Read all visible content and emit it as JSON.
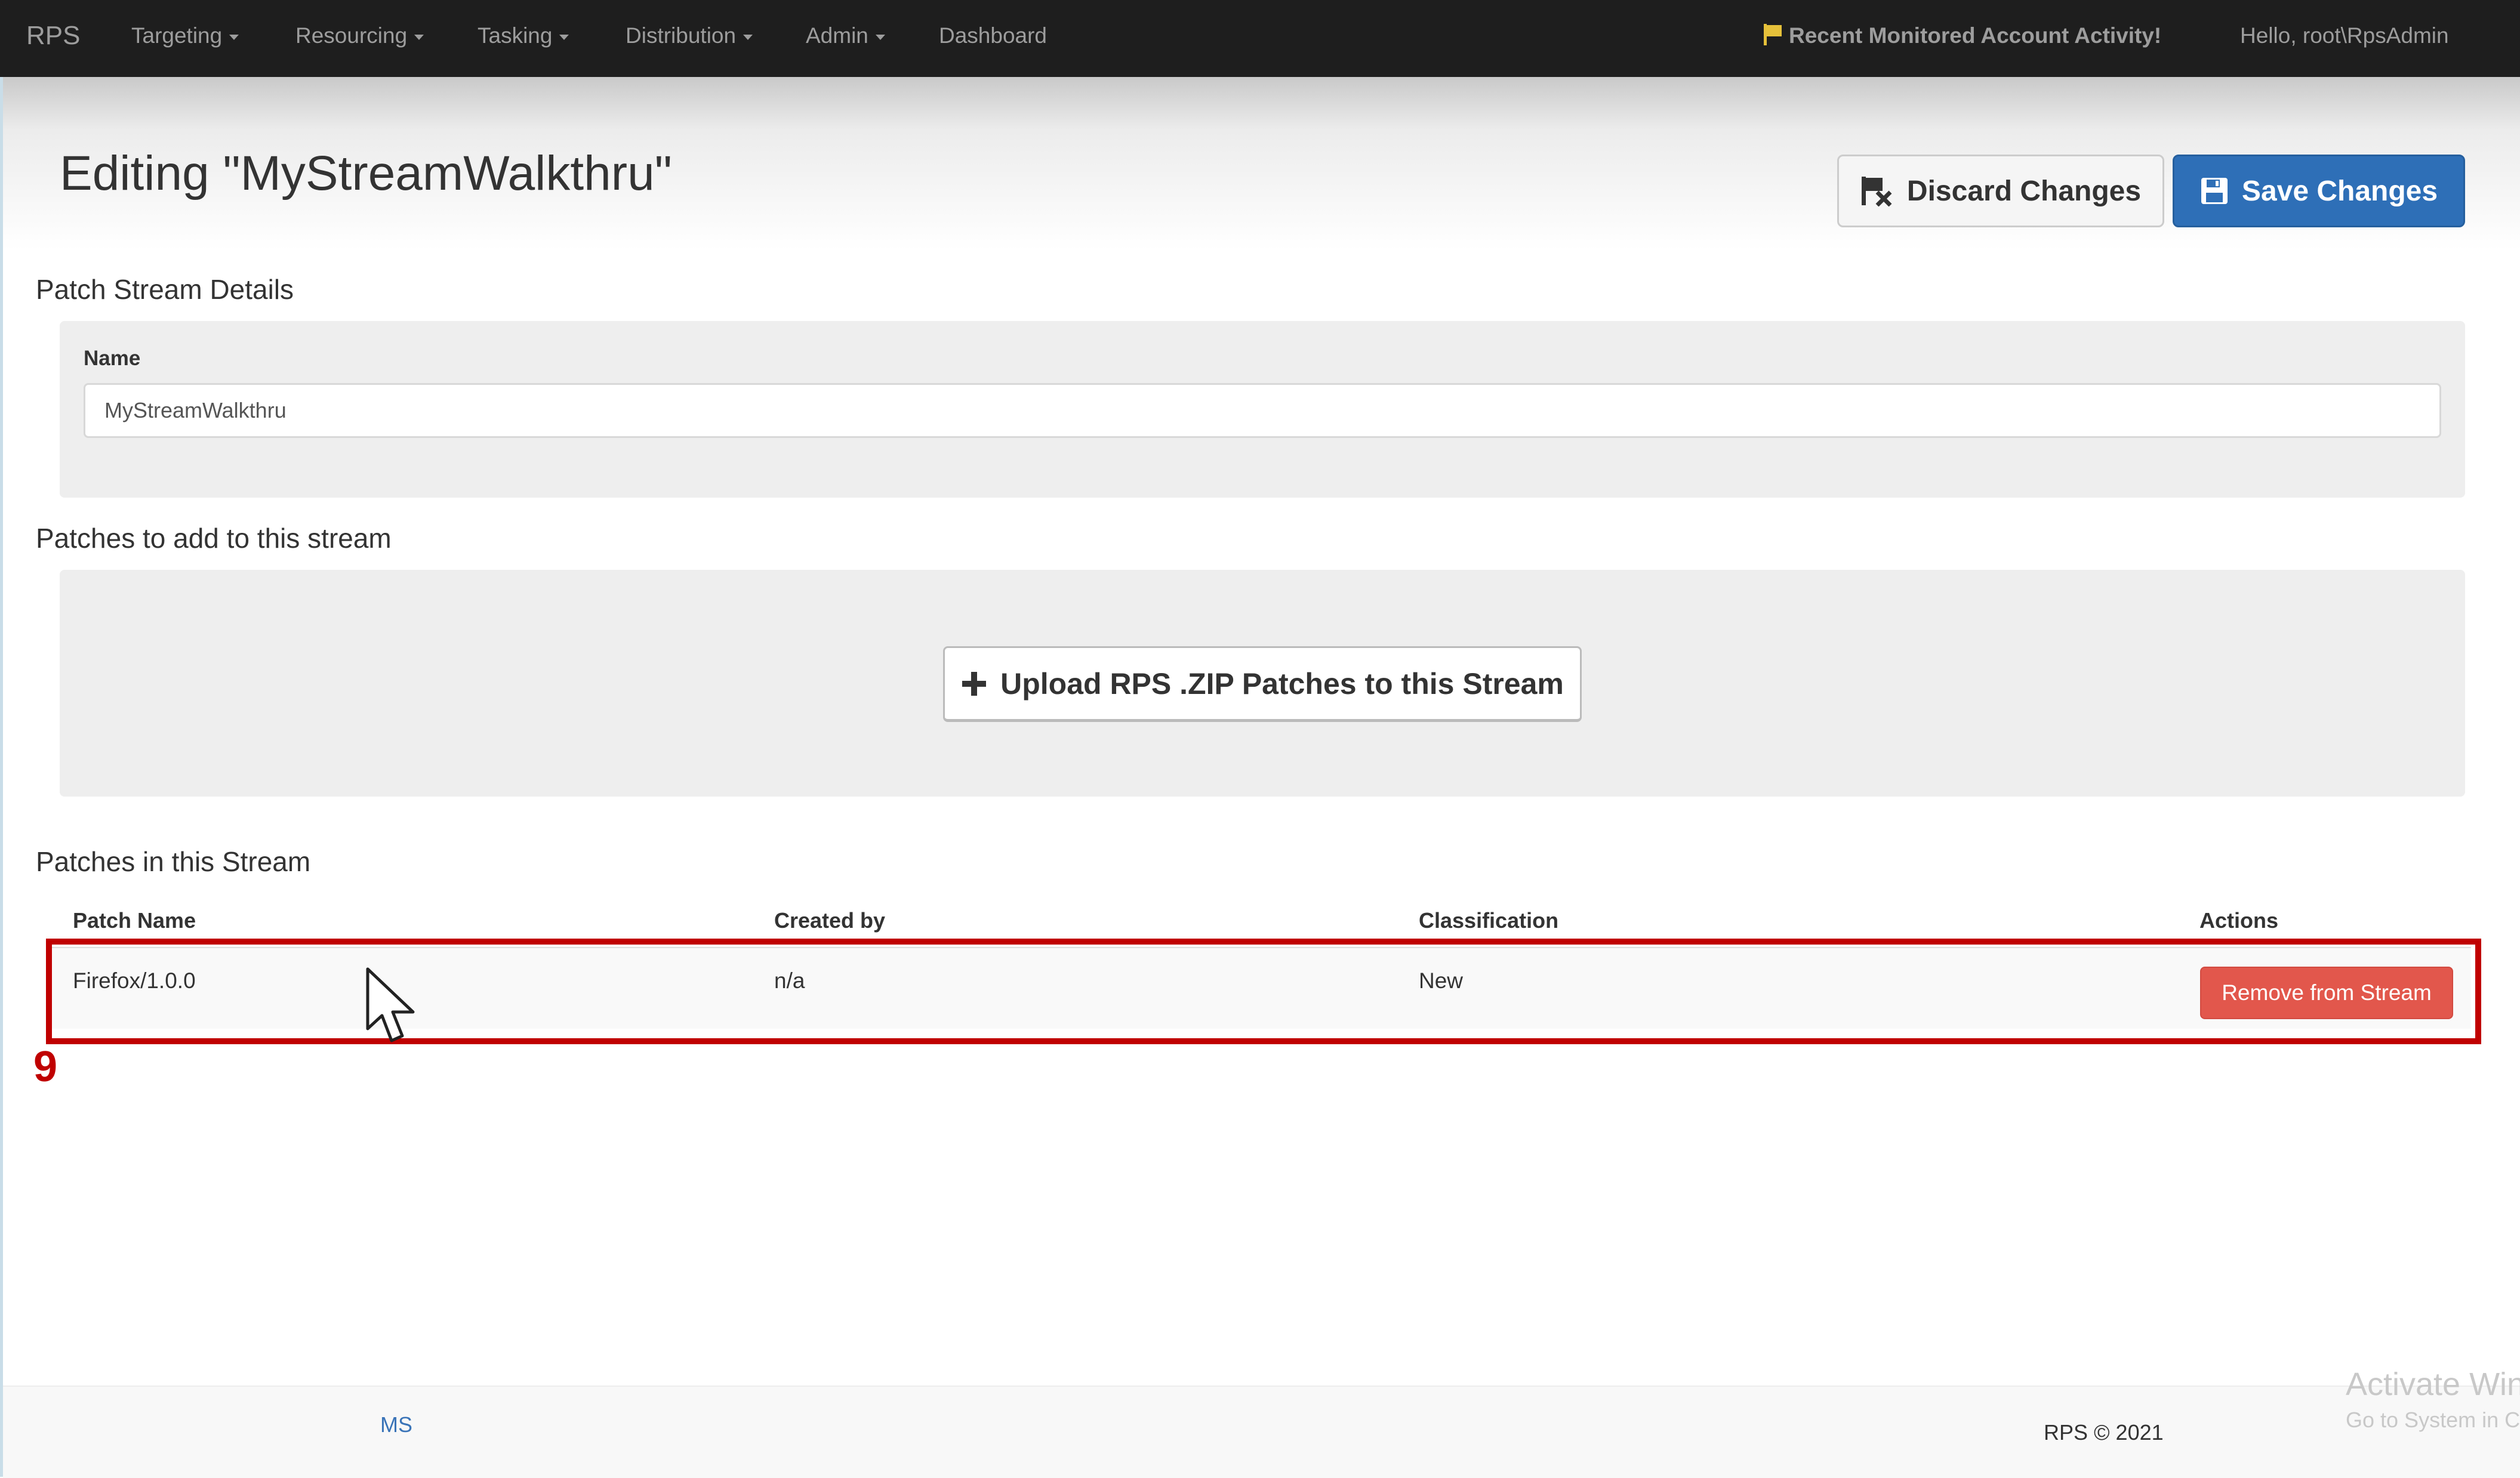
{
  "nav": {
    "brand": "RPS",
    "items": [
      {
        "label": "Targeting",
        "has_caret": true
      },
      {
        "label": "Resourcing",
        "has_caret": true
      },
      {
        "label": "Tasking",
        "has_caret": true
      },
      {
        "label": "Distribution",
        "has_caret": true
      },
      {
        "label": "Admin",
        "has_caret": true
      },
      {
        "label": "Dashboard",
        "has_caret": false
      }
    ],
    "activity_label": "Recent Monitored Account Activity!",
    "activity_icon": "flag-icon",
    "greeting": "Hello, root\\RpsAdmin"
  },
  "header": {
    "title": "Editing \"MyStreamWalkthru\"",
    "discard_label": "Discard Changes",
    "save_label": "Save Changes"
  },
  "details": {
    "section_title": "Patch Stream Details",
    "name_label": "Name",
    "name_value": "MyStreamWalkthru"
  },
  "add_patches": {
    "section_title": "Patches to add to this stream",
    "upload_label": "Upload RPS .ZIP Patches to this Stream",
    "upload_icon": "plus-icon"
  },
  "stream_patches": {
    "section_title": "Patches in this Stream",
    "columns": [
      "Patch Name",
      "Created by",
      "Classification",
      "Actions"
    ],
    "rows": [
      {
        "patch_name": "Firefox/1.0.0",
        "created_by": "n/a",
        "classification": "New",
        "action_label": "Remove from Stream"
      }
    ]
  },
  "annotation": {
    "step_number": "9"
  },
  "footer": {
    "link": "MS",
    "copyright": "RPS © 2021"
  },
  "watermark": {
    "title": "Activate Win",
    "subtitle": "Go to System in C"
  },
  "colors": {
    "navbar": "#1e1e1e",
    "primary": "#2e6fb7",
    "danger": "#e2574c",
    "highlight": "#c00000"
  }
}
